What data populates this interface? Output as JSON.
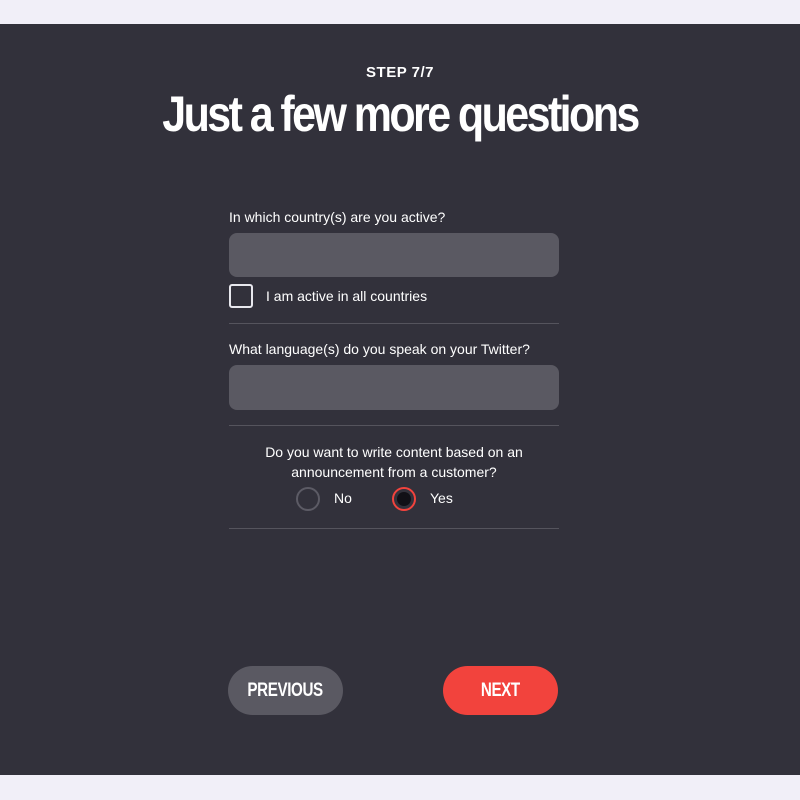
{
  "header": {
    "step": "STEP 7/7",
    "title": "Just a few more questions"
  },
  "form": {
    "country_label": "In which country(s) are you active?",
    "country_value": "",
    "all_countries_label": "I am active in all countries",
    "all_countries_checked": false,
    "language_label": "What language(s) do you speak on your Twitter?",
    "language_value": "",
    "announcement_question": "Do you want to write content based on an announcement from a customer?",
    "options": [
      {
        "label": "No",
        "selected": false
      },
      {
        "label": "Yes",
        "selected": true
      }
    ]
  },
  "nav": {
    "previous_label": "PREVIOUS",
    "next_label": "NEXT"
  },
  "colors": {
    "background": "#32313b",
    "input": "#5a5962",
    "accent": "#f2433d"
  }
}
